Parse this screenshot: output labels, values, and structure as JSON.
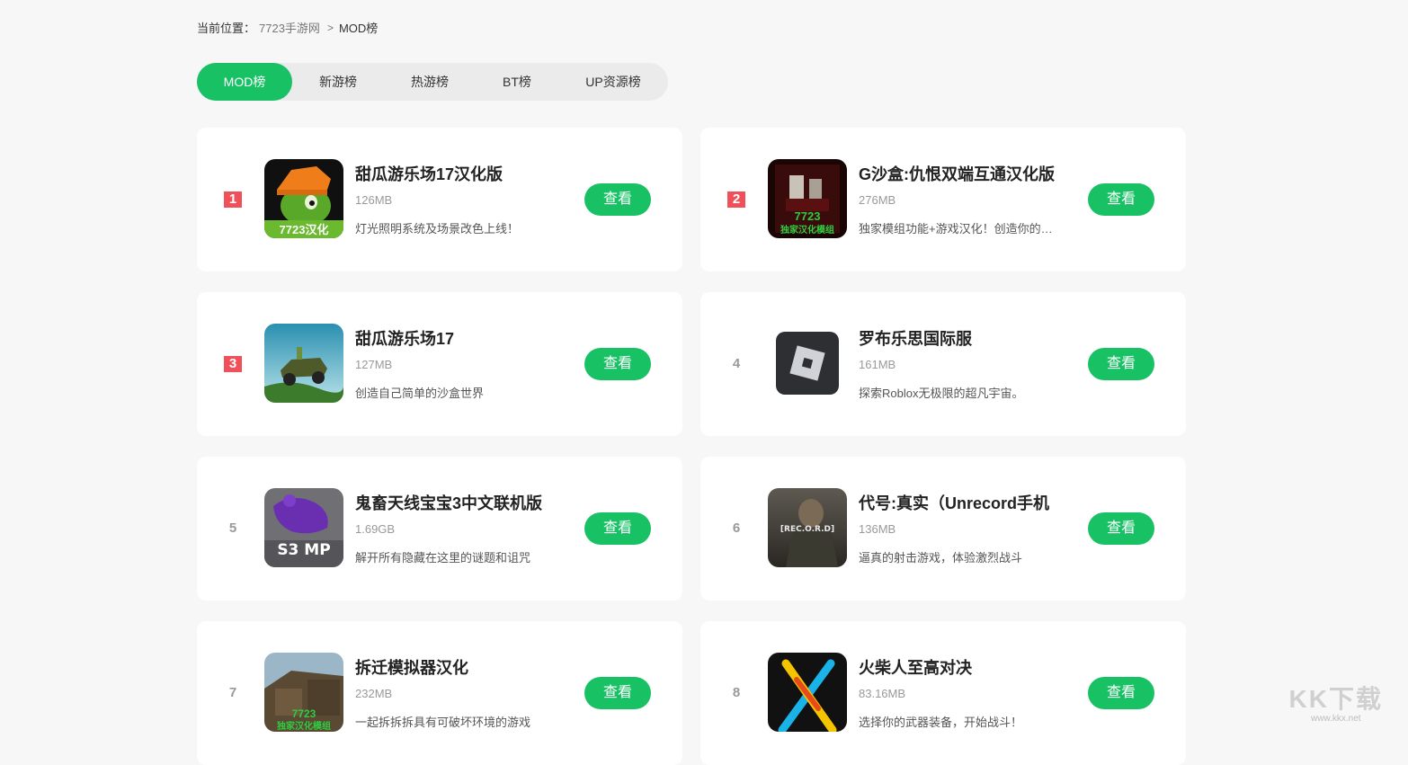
{
  "breadcrumb": {
    "prefix": "当前位置：",
    "home": "7723手游网",
    "separator": ">",
    "current": "MOD榜"
  },
  "tabs": [
    {
      "label": "MOD榜",
      "active": true
    },
    {
      "label": "新游榜",
      "active": false
    },
    {
      "label": "热游榜",
      "active": false
    },
    {
      "label": "BT榜",
      "active": false
    },
    {
      "label": "UP资源榜",
      "active": false
    }
  ],
  "games": [
    {
      "rank": "1",
      "name": "甜瓜游乐场17汉化版",
      "size": "126MB",
      "desc": "灯光照明系统及场景改色上线！",
      "button": "查看",
      "icon": "melon-playground-hanhua-icon"
    },
    {
      "rank": "2",
      "name": "G沙盒:仇恨双端互通汉化版",
      "size": "276MB",
      "desc": "独家模组功能+游戏汉化！创造你的世界",
      "button": "查看",
      "icon": "g-sandbox-icon"
    },
    {
      "rank": "3",
      "name": "甜瓜游乐场17",
      "size": "127MB",
      "desc": "创造自己简单的沙盒世界",
      "button": "查看",
      "icon": "melon-playground-icon"
    },
    {
      "rank": "4",
      "name": "罗布乐思国际服",
      "size": "161MB",
      "desc": "探索Roblox无极限的超凡宇宙。",
      "button": "查看",
      "icon": "roblox-icon"
    },
    {
      "rank": "5",
      "name": "鬼畜天线宝宝3中文联机版",
      "size": "1.69GB",
      "desc": "解开所有隐藏在这里的谜题和诅咒",
      "button": "查看",
      "icon": "slendytubbies-icon"
    },
    {
      "rank": "6",
      "name": "代号:真实（Unrecord手机",
      "size": "136MB",
      "desc": "逼真的射击游戏，体验激烈战斗",
      "button": "查看",
      "icon": "unrecord-icon"
    },
    {
      "rank": "7",
      "name": "拆迁模拟器汉化",
      "size": "232MB",
      "desc": "一起拆拆拆具有可破坏环境的游戏",
      "button": "查看",
      "icon": "demolition-icon"
    },
    {
      "rank": "8",
      "name": "火柴人至高对决",
      "size": "83.16MB",
      "desc": "选择你的武器装备，开始战斗！",
      "button": "查看",
      "icon": "stickman-icon"
    }
  ],
  "icon_labels": {
    "badge_7723": "7723汉化",
    "badge_7723_short": "7723",
    "badge_mod": "独家汉化模组",
    "s3mp": "S3 MP",
    "record": "[REC.O.R.D]"
  },
  "watermark": {
    "logo": "KK下载",
    "url": "www.kkx.net"
  },
  "colors": {
    "accent": "#19c165",
    "rank_top": "#f0505a",
    "background": "#f7f7f7"
  }
}
